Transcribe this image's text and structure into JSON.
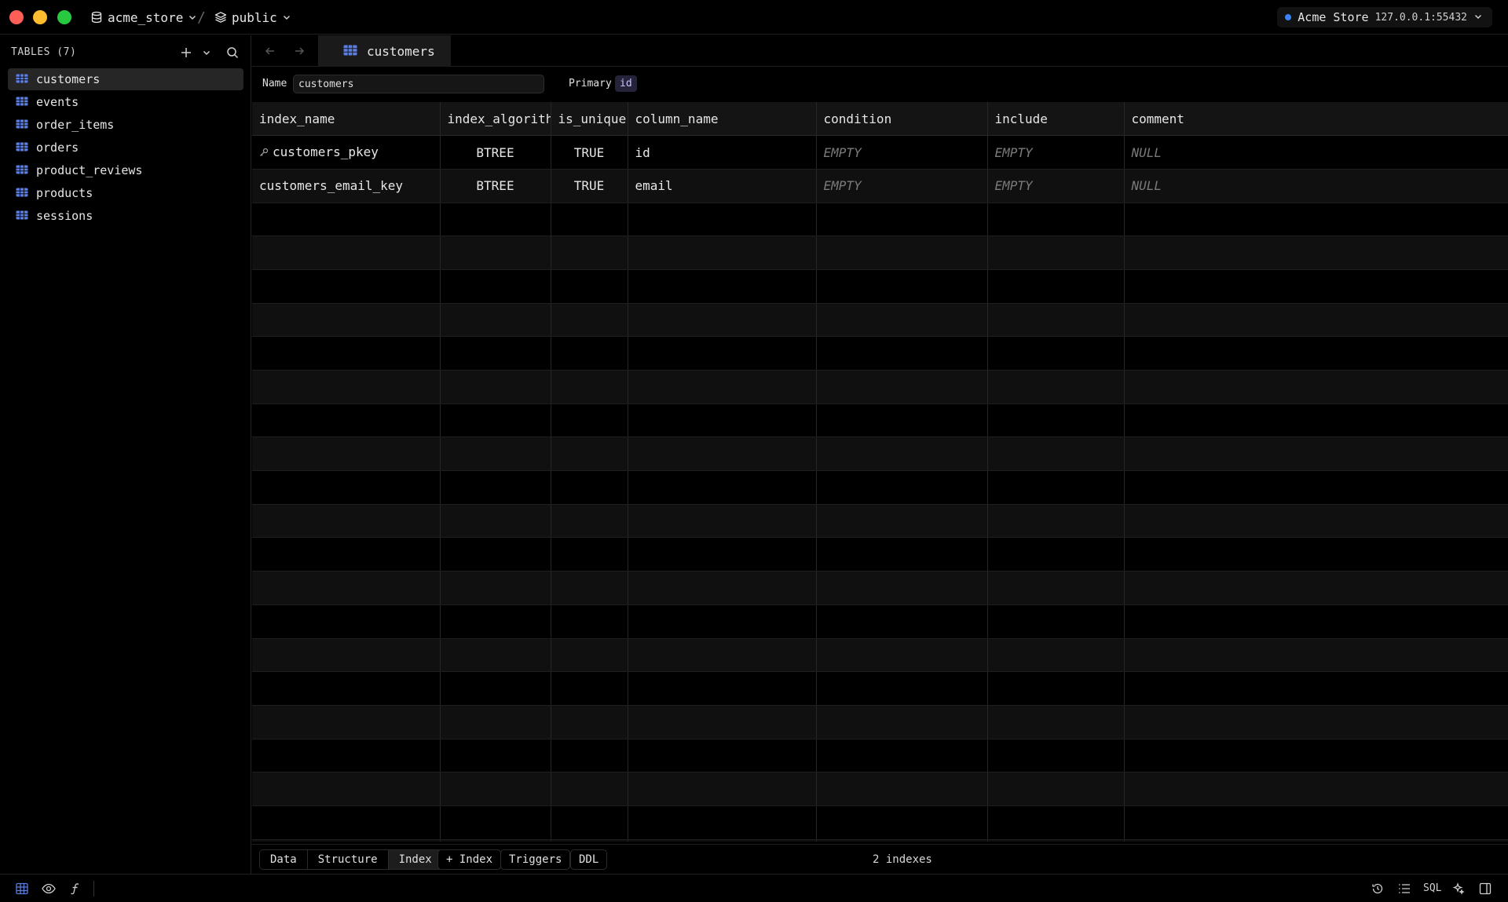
{
  "titlebar": {
    "database": "acme_store",
    "separator": "/",
    "schema": "public",
    "connection_name": "Acme Store",
    "connection_host": "127.0.0.1:55432"
  },
  "sidebar": {
    "header": "TABLES (7)",
    "tables": [
      {
        "name": "customers",
        "active": true
      },
      {
        "name": "events"
      },
      {
        "name": "order_items"
      },
      {
        "name": "orders"
      },
      {
        "name": "product_reviews"
      },
      {
        "name": "products"
      },
      {
        "name": "sessions"
      }
    ]
  },
  "tab": {
    "label": "customers"
  },
  "meta": {
    "name_label": "Name",
    "name_value": "customers",
    "primary_label": "Primary",
    "primary_value": "id"
  },
  "grid": {
    "columns": [
      "index_name",
      "index_algorithm",
      "is_unique",
      "column_name",
      "condition",
      "include",
      "comment"
    ],
    "rows": [
      {
        "index_name": "customers_pkey",
        "index_algorithm": "BTREE",
        "is_unique": "TRUE",
        "column_name": "id",
        "condition": "EMPTY",
        "include": "EMPTY",
        "comment": "NULL",
        "primary": true
      },
      {
        "index_name": "customers_email_key",
        "index_algorithm": "BTREE",
        "is_unique": "TRUE",
        "column_name": "email",
        "condition": "EMPTY",
        "include": "EMPTY",
        "comment": "NULL",
        "primary": false
      }
    ],
    "filler_rows": 20
  },
  "bottombar": {
    "segments": [
      {
        "label": "Data"
      },
      {
        "label": "Structure"
      },
      {
        "label": "Index",
        "active": true
      }
    ],
    "add_index_label": "+ Index",
    "triggers_label": "Triggers",
    "ddl_label": "DDL",
    "index_count": "2 indexes"
  },
  "statusbar": {
    "sql_label": "SQL"
  },
  "colors": {
    "accent": "#3b82f6",
    "table_icon": "#5b7fe0",
    "pk_badge_bg": "#25233a",
    "pk_badge_fg": "#c9c3ff"
  }
}
